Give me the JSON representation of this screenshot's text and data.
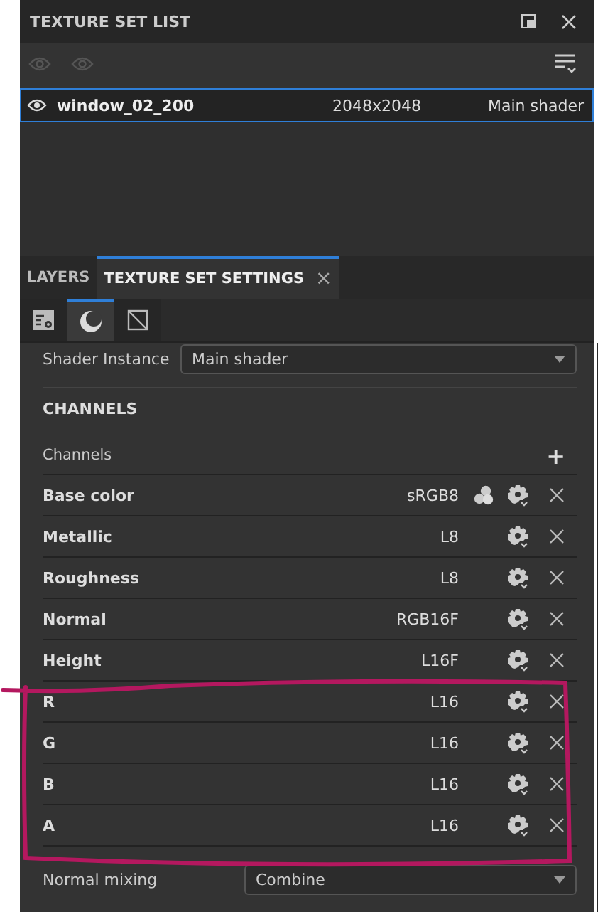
{
  "texture_set_list": {
    "title": "TEXTURE SET LIST",
    "rows": [
      {
        "name": "window_02_200",
        "resolution": "2048x2048",
        "shader": "Main shader",
        "selected": true
      }
    ]
  },
  "tabs": [
    {
      "label": "LAYERS",
      "selected": false
    },
    {
      "label": "TEXTURE SET SETTINGS",
      "selected": true,
      "close": "×"
    }
  ],
  "sub_tabs": [
    {
      "selected": false
    },
    {
      "selected": true
    },
    {
      "selected": false
    }
  ],
  "shader_instance": {
    "label": "Shader Instance",
    "value": "Main shader"
  },
  "section_title": "CHANNELS",
  "channels_header": {
    "label": "Channels",
    "add": "+"
  },
  "channels": [
    {
      "name": "Base color",
      "format": "sRGB8",
      "kind": "color"
    },
    {
      "name": "Metallic",
      "format": "L8",
      "kind": "scalar"
    },
    {
      "name": "Roughness",
      "format": "L8",
      "kind": "scalar"
    },
    {
      "name": "Normal",
      "format": "RGB16F",
      "kind": "scalar"
    },
    {
      "name": "Height",
      "format": "L16F",
      "kind": "scalar"
    },
    {
      "name": "R",
      "format": "L16",
      "kind": "scalar"
    },
    {
      "name": "G",
      "format": "L16",
      "kind": "scalar"
    },
    {
      "name": "B",
      "format": "L16",
      "kind": "scalar"
    },
    {
      "name": "A",
      "format": "L16",
      "kind": "scalar"
    }
  ],
  "normal_mixing": {
    "label": "Normal mixing",
    "value": "Combine"
  }
}
